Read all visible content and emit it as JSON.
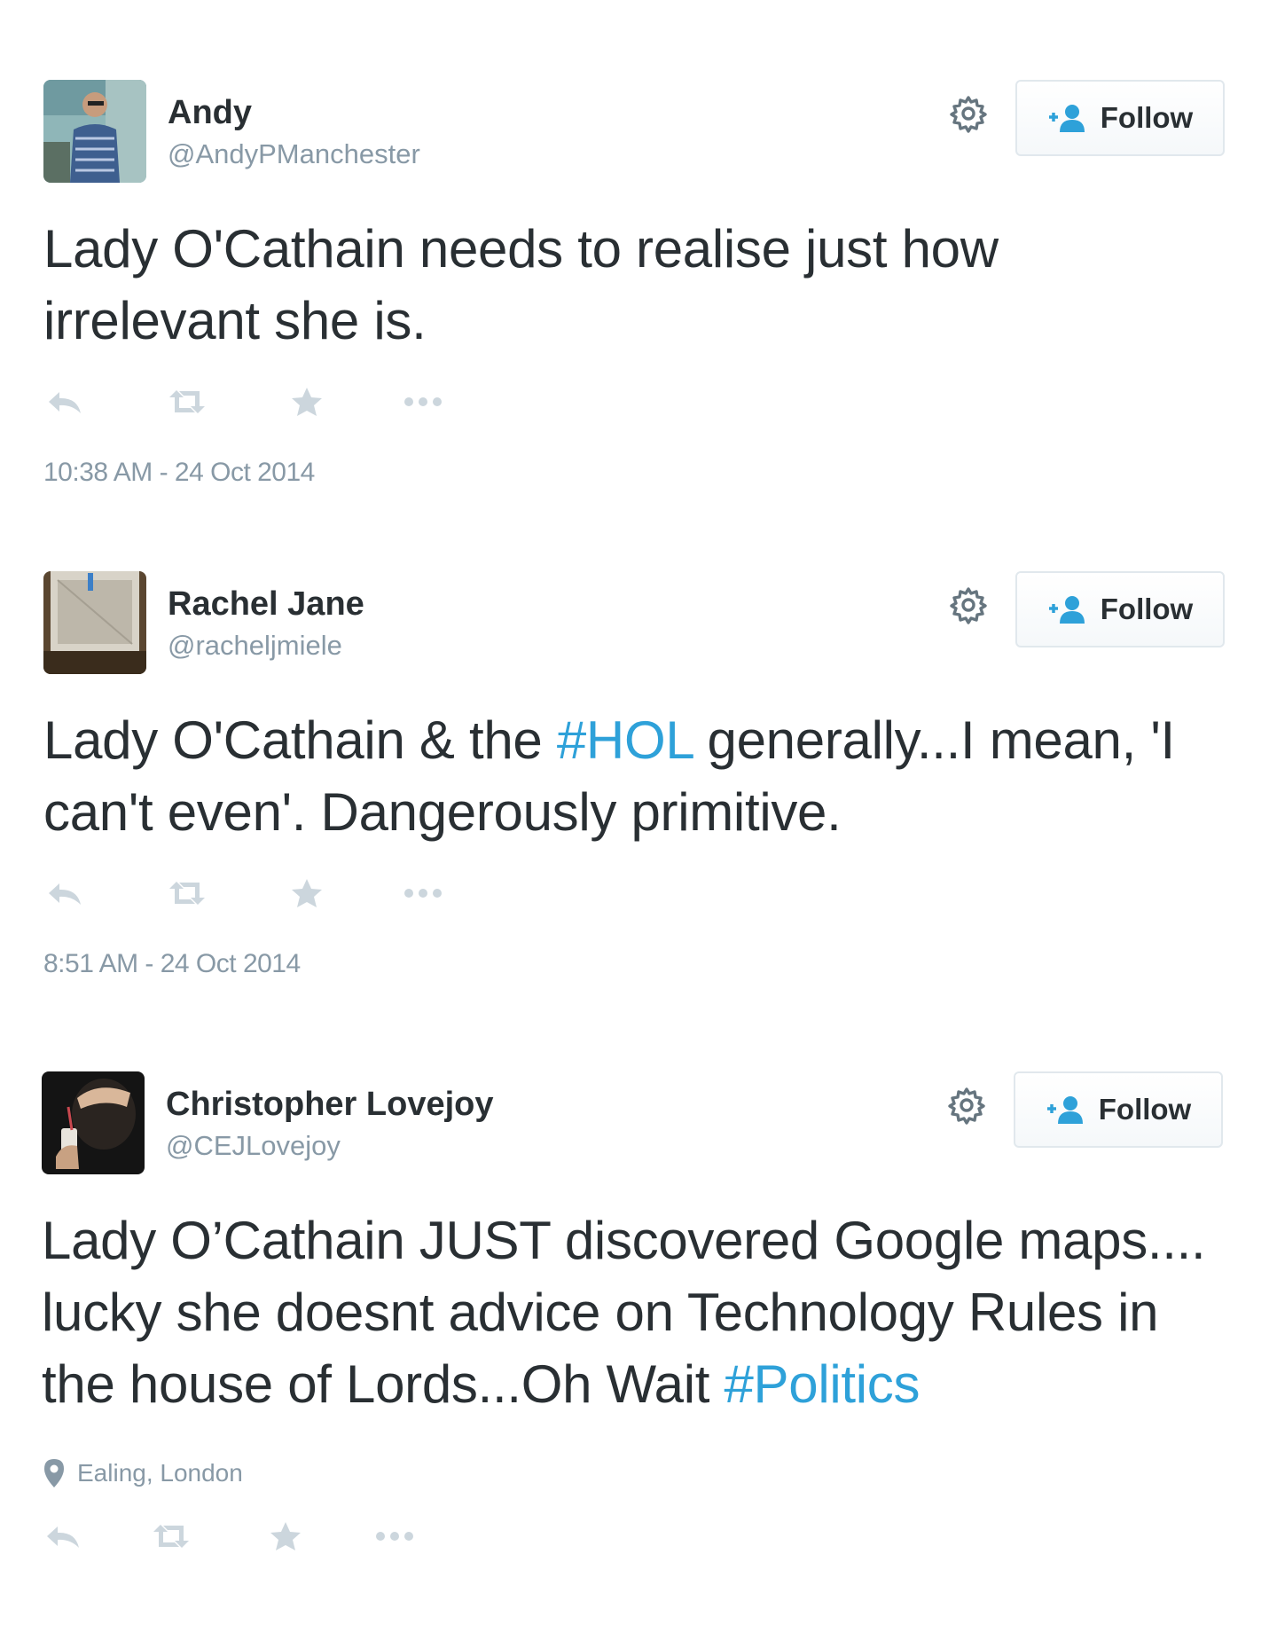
{
  "tweets": [
    {
      "name": "Andy",
      "handle": "@AndyPManchester",
      "follow_label": "Follow",
      "text_parts": [
        "Lady O'Cathain needs to realise just how irrelevant she is."
      ],
      "timestamp": "10:38 AM - 24 Oct 2014"
    },
    {
      "name": "Rachel Jane",
      "handle": "@racheljmiele",
      "follow_label": "Follow",
      "text_parts": [
        "Lady O'Cathain & the ",
        "#HOL",
        " generally...I mean, 'I can't even'. Dangerously primitive."
      ],
      "timestamp": "8:51 AM - 24 Oct 2014"
    },
    {
      "name": "Christopher Lovejoy",
      "handle": "@CEJLovejoy",
      "follow_label": "Follow",
      "text_parts": [
        "Lady O’Cathain JUST discovered Google maps.... lucky she doesnt advice on Technology Rules in the house of Lords...Oh Wait ",
        "#Politics"
      ],
      "location": "Ealing, London"
    }
  ],
  "colors": {
    "hashtag": "#2ea1d9",
    "follow_icon": "#2ea1d9",
    "muted": "#8899a6",
    "action_icons": "#ccd6dd",
    "text": "#292f33"
  },
  "icons": {
    "gear": "gear-icon",
    "follow": "follow-person-icon",
    "reply": "reply-icon",
    "retweet": "retweet-icon",
    "favorite": "star-icon",
    "more": "more-dots-icon",
    "location": "location-pin-icon"
  }
}
